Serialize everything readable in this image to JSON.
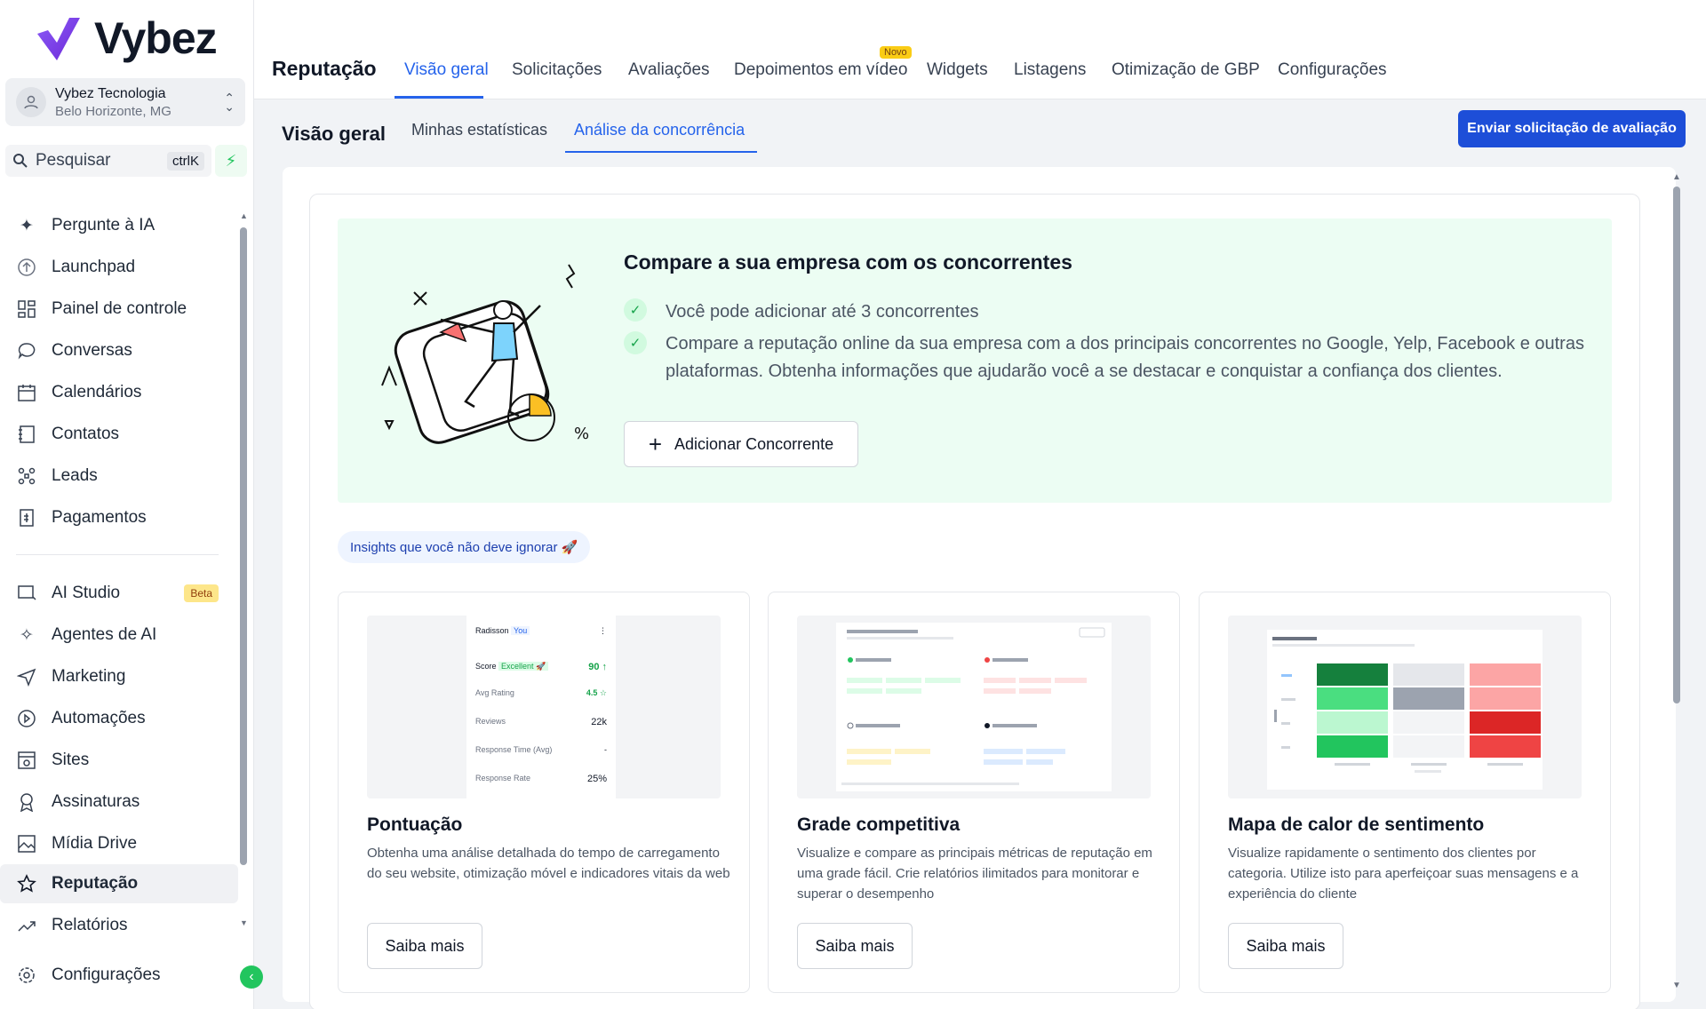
{
  "app": {
    "name": "Vybez"
  },
  "account": {
    "name": "Vybez Tecnologia",
    "location": "Belo Horizonte, MG"
  },
  "search": {
    "placeholder": "Pesquisar",
    "shortcut": "ctrlK"
  },
  "sidebar": {
    "items": [
      {
        "label": "Pergunte à IA",
        "icon": "sparkles-icon"
      },
      {
        "label": "Launchpad",
        "icon": "rocket-icon"
      },
      {
        "label": "Painel de controle",
        "icon": "dashboard-icon"
      },
      {
        "label": "Conversas",
        "icon": "chat-icon"
      },
      {
        "label": "Calendários",
        "icon": "calendar-icon"
      },
      {
        "label": "Contatos",
        "icon": "contacts-icon"
      },
      {
        "label": "Leads",
        "icon": "leads-icon"
      },
      {
        "label": "Pagamentos",
        "icon": "receipt-icon"
      }
    ],
    "items2": [
      {
        "label": "AI Studio",
        "icon": "ai-studio-icon",
        "badge": "Beta"
      },
      {
        "label": "Agentes de AI",
        "icon": "ai-agents-icon"
      },
      {
        "label": "Marketing",
        "icon": "send-icon"
      },
      {
        "label": "Automações",
        "icon": "automation-icon"
      },
      {
        "label": "Sites",
        "icon": "sites-icon"
      },
      {
        "label": "Assinaturas",
        "icon": "award-icon"
      },
      {
        "label": "Mídia Drive",
        "icon": "image-icon"
      },
      {
        "label": "Reputação",
        "icon": "star-icon",
        "active": true
      },
      {
        "label": "Relatórios",
        "icon": "trend-icon"
      }
    ],
    "settings": {
      "label": "Configurações",
      "icon": "gear-icon"
    }
  },
  "topnav": {
    "title": "Reputação",
    "tabs": [
      "Visão geral",
      "Solicitações",
      "Avaliações",
      "Depoimentos em vídeo",
      "Widgets",
      "Listagens",
      "Otimização de GBP",
      "Configurações"
    ],
    "active": "Visão geral",
    "new_badge": "Novo"
  },
  "subnav": {
    "title": "Visão geral",
    "tabs": [
      "Minhas estatísticas",
      "Análise da concorrência"
    ],
    "active": "Análise da concorrência",
    "cta": "Enviar solicitação de avaliação"
  },
  "hero": {
    "title": "Compare a sua empresa com os concorrentes",
    "points": [
      "Você pode adicionar até 3 concorrentes",
      "Compare a reputação online da sua empresa com a dos principais concorrentes no Google, Yelp, Facebook e outras plataformas. Obtenha informações que ajudarão você a se destacar e conquistar a confiança dos clientes."
    ],
    "button": "Adicionar Concorrente"
  },
  "insights_label": "Insights que você não deve ignorar 🚀",
  "cards": [
    {
      "title": "Pontuação",
      "desc": "Obtenha uma análise detalhada do tempo de carregamento do seu website, otimização móvel e indicadores vitais da web",
      "button": "Saiba mais"
    },
    {
      "title": "Grade competitiva",
      "desc": "Visualize e compare as principais métricas de reputação em uma grade fácil. Crie relatórios ilimitados para monitorar e superar o desempenho",
      "button": "Saiba mais"
    },
    {
      "title": "Mapa de calor de sentimento",
      "desc": "Visualize rapidamente o sentimento dos clientes por categoria. Utilize isto para aperfeiçoar suas mensagens e a experiência do cliente",
      "button": "Saiba mais"
    }
  ],
  "score_preview": {
    "name": "Radisson",
    "you": "You",
    "rows": [
      {
        "label": "Score",
        "tag": "Excellent 🚀",
        "value": "90 ↑"
      },
      {
        "label": "Avg Rating",
        "value": "4.5 ☆"
      },
      {
        "label": "Reviews",
        "value": "22k"
      },
      {
        "label": "Response Time (Avg)",
        "value": "-"
      },
      {
        "label": "Response Rate",
        "value": "25%"
      }
    ]
  },
  "colors": {
    "accent": "#2563eb",
    "brand": "#7c3aed",
    "success": "#22c55e",
    "hero_bg": "#ecfdf3"
  }
}
